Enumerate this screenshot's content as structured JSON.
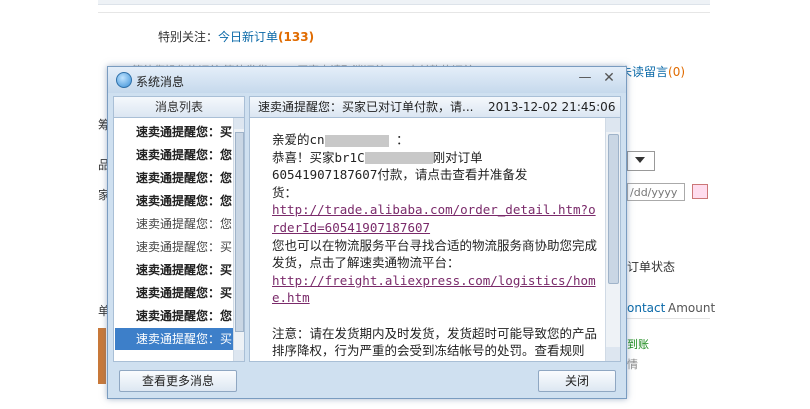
{
  "background_page": {
    "special_label": "特别关注：",
    "new_orders_link": "今日新订单",
    "new_orders_count": "(133)",
    "row2_text": "等待您操作的订单    等待发货 (12)    买家申请取消订单 (0)    未付款的订单 (0)",
    "unread_link": "未读留言",
    "unread_count": "(0)",
    "left_chars": [
      "筹",
      "品",
      "家",
      "单"
    ],
    "date_placeholder": "/dd/yyyy",
    "order_status_header": "订单状态",
    "contact_link": "ontact",
    "amount_header": "Amount",
    "paid_text": "到账",
    "love_text": "情"
  },
  "dialog": {
    "title": "系统消息",
    "minimize_glyph": "—",
    "close_glyph": "✕",
    "list_header": "消息列表",
    "messages": [
      {
        "label": "速卖通提醒您：买...",
        "style": "bold"
      },
      {
        "label": "速卖通提醒您：您...",
        "style": "bold"
      },
      {
        "label": "速卖通提醒您：您...",
        "style": "bold"
      },
      {
        "label": "速卖通提醒您：您...",
        "style": "bold"
      },
      {
        "label": "速卖通提醒您：您...",
        "style": "normal"
      },
      {
        "label": "速卖通提醒您：买...",
        "style": "normal"
      },
      {
        "label": "速卖通提醒您：买...",
        "style": "bold"
      },
      {
        "label": "速卖通提醒您：买...",
        "style": "bold"
      },
      {
        "label": "速卖通提醒您：您...",
        "style": "bold"
      },
      {
        "label": "速卖通提醒您：买...",
        "style": "selected"
      }
    ],
    "detail_subject": "速卖通提醒您：买家已对订单付款，请...",
    "detail_date": "2013-12-02 21:45:06",
    "body": {
      "greeting_prefix": "亲爱的cn",
      "greeting_suffix": " ：",
      "congrats_prefix": "恭喜！买家br1C",
      "congrats_suffix": "刚对订单",
      "order_line": "60541907187607付款，请点击查看并准备发",
      "order_line2": "货：",
      "order_link": "http://trade.alibaba.com/order_detail.htm?orderId=60541907187607",
      "logistics_text": "您也可以在物流服务平台寻找合适的物流服务商协助您完成发货，点击了解速卖通物流平台：",
      "logistics_link": "http://freight.aliexpress.com/logistics/home.htm",
      "notice_text": "注意：请在发货期内及时发货，发货超时可能导致您的产品排序降权，行为严重的会受到冻结帐号的处罚。查看规则"
    },
    "more_button": "查看更多消息",
    "close_button": "关闭"
  }
}
